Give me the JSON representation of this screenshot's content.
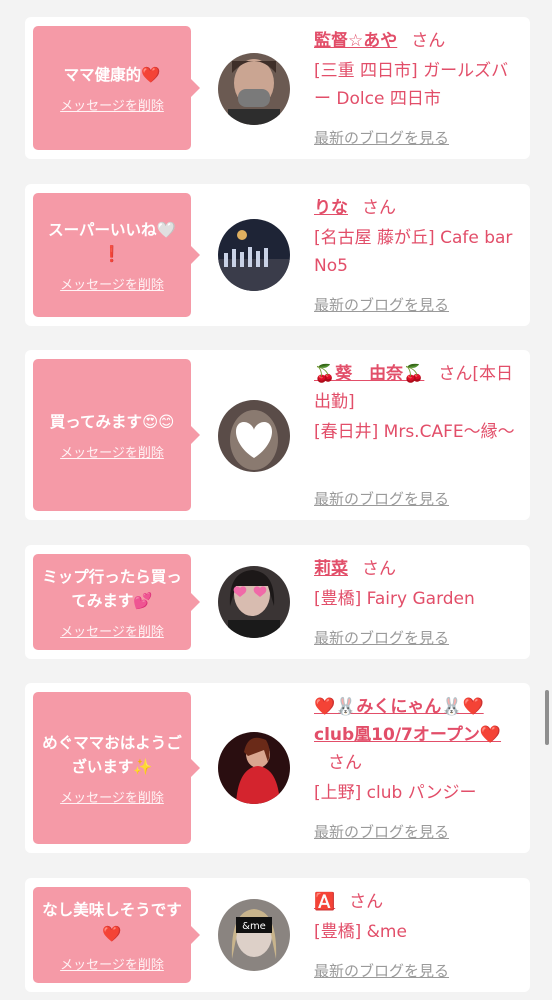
{
  "delete_label": "メッセージを削除",
  "blog_label": "最新のブログを見る",
  "san": "さん",
  "cards": [
    {
      "message": "ママ健康的❤️",
      "name": "監督☆あや",
      "shop": "[三重 四日市] ガールズバー Dolce 四日市"
    },
    {
      "message": "スーパーいいね🤍❗",
      "name": "りな",
      "shop": "[名古屋 藤が丘] Cafe bar No5"
    },
    {
      "message": "買ってみます😍😊",
      "name": "🍒葵　由奈🍒",
      "name_suffix": "[本日出勤]",
      "shop": "[春日井] Mrs.CAFE〜縁〜"
    },
    {
      "message": "ミップ行ったら買ってみます💕",
      "name": "莉菜",
      "shop": "[豊橋] Fairy Garden"
    },
    {
      "message": "めぐママおはようございます✨",
      "name": "❤️🐰みくにゃん🐰❤️club凰10/7オープン❤️",
      "shop": "[上野] club パンジー"
    },
    {
      "message": "なし美味しそうです❤️",
      "name": "🅰️",
      "shop": "[豊橋] &me"
    }
  ],
  "avatar_icons": [
    "woman-mask-photo",
    "bar-interior-photo",
    "heart-face-photo",
    "heart-eyes-photo",
    "red-dress-photo",
    "andme-logo-photo"
  ],
  "colors": {
    "accent": "#e24e69",
    "bubble": "#f59aa7",
    "link_gray": "#9a9a9a",
    "background": "#f3f3f3"
  }
}
